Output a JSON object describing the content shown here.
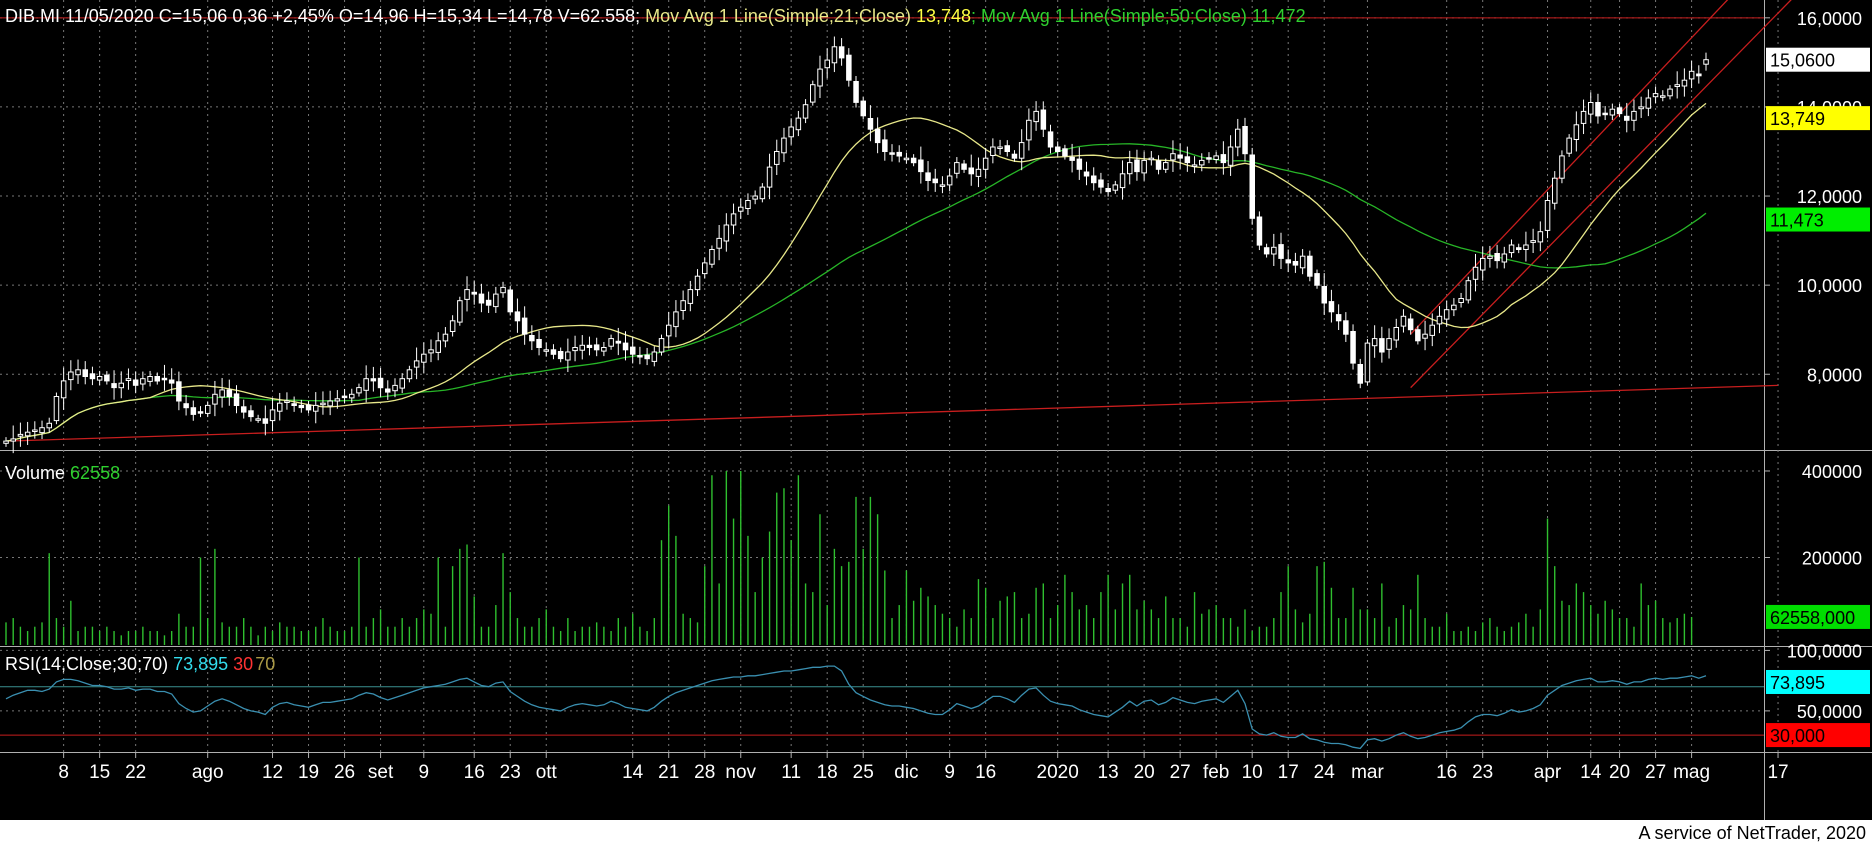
{
  "header": {
    "symbol": "DIB.MI 11/05/2020",
    "ohlc": " C=15,06 0,36 +2,45% O=14,96 H=15,34 L=14,78 V=62.558;",
    "ma21_label": " Mov Avg 1 Line(Simple;21;Close) ",
    "ma21_value": "13,748",
    "ma50_label": "; Mov Avg 1 Line(Simple;50;Close) ",
    "ma50_value": "11,472"
  },
  "colors": {
    "background": "#000000",
    "candle": "#ffffff",
    "ma21": "#e8e88a",
    "ma50": "#27b527",
    "volume": "#2fbf2f",
    "rsi": "#3a8fb0",
    "trendline": "#c81e1e",
    "grid": "#777777",
    "ma21_badge": "#ffff00",
    "ma50_badge": "#00ee00",
    "vol_badge": "#00dd00",
    "rsi_badge": "#00ffff",
    "rsi30_badge": "#ff0000"
  },
  "chart_data": [
    {
      "type": "candlestick",
      "panel": "price",
      "y_ticks": [
        "16,0000",
        "14,0000",
        "12,0000",
        "10,0000",
        "8,0000"
      ],
      "ylim": [
        6.3,
        16.4
      ],
      "badges": {
        "last": "15,0600",
        "ma21": "13,749",
        "ma50": "11,473"
      },
      "series": [
        {
          "name": "Mov Avg 1 Line(Simple;21;Close)",
          "color_key": "ma21"
        },
        {
          "name": "Mov Avg 1 Line(Simple;50;Close)",
          "color_key": "ma50"
        }
      ],
      "close": [
        6.5,
        6.55,
        6.65,
        6.7,
        6.75,
        6.8,
        6.9,
        7.5,
        7.85,
        8.05,
        8.1,
        7.95,
        7.9,
        7.95,
        7.85,
        7.7,
        7.8,
        7.9,
        7.75,
        7.9,
        7.95,
        7.85,
        7.9,
        7.8,
        7.4,
        7.25,
        7.1,
        7.15,
        7.3,
        7.55,
        7.65,
        7.5,
        7.3,
        7.15,
        7.05,
        7.0,
        6.9,
        7.2,
        7.35,
        7.4,
        7.3,
        7.25,
        7.2,
        7.3,
        7.35,
        7.4,
        7.45,
        7.5,
        7.55,
        7.7,
        7.9,
        7.85,
        7.7,
        7.6,
        7.75,
        7.9,
        8.1,
        8.3,
        8.45,
        8.55,
        8.75,
        8.9,
        9.2,
        9.65,
        9.9,
        9.8,
        9.6,
        9.55,
        9.8,
        9.95,
        9.4,
        9.2,
        8.9,
        8.75,
        8.6,
        8.55,
        8.45,
        8.35,
        8.5,
        8.6,
        8.65,
        8.6,
        8.55,
        8.6,
        8.8,
        8.7,
        8.55,
        8.45,
        8.4,
        8.35,
        8.5,
        8.8,
        9.1,
        9.4,
        9.65,
        9.9,
        10.2,
        10.5,
        10.8,
        11.05,
        11.35,
        11.6,
        11.75,
        11.9,
        12.0,
        12.2,
        12.65,
        13.0,
        13.3,
        13.55,
        13.75,
        14.05,
        14.5,
        14.85,
        15.05,
        15.35,
        15.1,
        14.6,
        14.1,
        13.8,
        13.5,
        13.2,
        13.0,
        12.95,
        12.9,
        12.85,
        12.75,
        12.55,
        12.35,
        12.3,
        12.25,
        12.45,
        12.75,
        12.6,
        12.5,
        12.6,
        12.85,
        13.1,
        13.1,
        13.0,
        12.85,
        13.2,
        13.7,
        13.9,
        13.5,
        13.1,
        13.0,
        12.9,
        12.8,
        12.6,
        12.45,
        12.3,
        12.2,
        12.1,
        12.25,
        12.5,
        12.75,
        12.55,
        12.8,
        12.85,
        12.6,
        12.75,
        12.95,
        12.85,
        12.75,
        12.7,
        12.8,
        12.85,
        12.9,
        12.75,
        13.1,
        13.5,
        12.95,
        11.5,
        10.9,
        10.7,
        10.85,
        10.6,
        10.5,
        10.45,
        10.65,
        10.2,
        10.0,
        9.6,
        9.4,
        9.2,
        8.9,
        8.25,
        7.8,
        8.7,
        8.8,
        8.5,
        8.8,
        9.05,
        9.3,
        9.0,
        8.75,
        8.9,
        9.1,
        9.3,
        9.45,
        9.55,
        9.7,
        10.1,
        10.4,
        10.6,
        10.65,
        10.55,
        10.7,
        10.9,
        10.8,
        10.9,
        11.0,
        11.2,
        11.9,
        12.4,
        12.9,
        13.3,
        13.6,
        13.9,
        14.1,
        13.8,
        13.85,
        13.95,
        13.85,
        13.7,
        13.9,
        14.0,
        14.2,
        14.3,
        14.25,
        14.4,
        14.5,
        14.6,
        14.8,
        14.7,
        15.06
      ]
    },
    {
      "type": "bar",
      "panel": "volume",
      "title": "Volume",
      "value_label": "62558",
      "badge": "62558,000",
      "y_ticks": [
        "400000",
        "200000"
      ],
      "ylim": [
        0,
        430000
      ],
      "values": [
        50000,
        60000,
        40000,
        30000,
        40000,
        50000,
        210000,
        60000,
        40000,
        100000,
        30000,
        40000,
        40000,
        30000,
        40000,
        30000,
        20000,
        30000,
        30000,
        40000,
        30000,
        30000,
        20000,
        30000,
        70000,
        40000,
        40000,
        200000,
        60000,
        220000,
        50000,
        40000,
        40000,
        60000,
        40000,
        20000,
        40000,
        30000,
        50000,
        40000,
        40000,
        30000,
        30000,
        40000,
        60000,
        40000,
        30000,
        30000,
        40000,
        200000,
        40000,
        60000,
        80000,
        40000,
        40000,
        60000,
        40000,
        60000,
        80000,
        70000,
        200000,
        40000,
        180000,
        220000,
        230000,
        110000,
        40000,
        40000,
        90000,
        210000,
        120000,
        60000,
        40000,
        40000,
        60000,
        80000,
        40000,
        30000,
        60000,
        30000,
        40000,
        40000,
        50000,
        40000,
        30000,
        60000,
        40000,
        70000,
        40000,
        30000,
        60000,
        240000,
        320000,
        250000,
        70000,
        60000,
        50000,
        180000,
        390000,
        140000,
        400000,
        290000,
        400000,
        250000,
        120000,
        200000,
        260000,
        350000,
        360000,
        240000,
        390000,
        140000,
        120000,
        300000,
        90000,
        220000,
        180000,
        190000,
        340000,
        220000,
        340000,
        300000,
        170000,
        60000,
        90000,
        170000,
        100000,
        130000,
        110000,
        90000,
        70000,
        60000,
        40000,
        80000,
        60000,
        150000,
        130000,
        60000,
        100000,
        110000,
        120000,
        60000,
        70000,
        130000,
        140000,
        60000,
        90000,
        160000,
        120000,
        80000,
        90000,
        60000,
        120000,
        160000,
        80000,
        140000,
        160000,
        80000,
        100000,
        80000,
        60000,
        110000,
        60000,
        60000,
        40000,
        120000,
        70000,
        80000,
        90000,
        60000,
        60000,
        40000,
        80000,
        30000,
        40000,
        40000,
        60000,
        120000,
        180000,
        80000,
        50000,
        70000,
        180000,
        190000,
        130000,
        60000,
        60000,
        130000,
        80000,
        80000,
        60000,
        140000,
        40000,
        60000,
        90000,
        80000,
        160000,
        60000,
        40000,
        40000,
        70000,
        30000,
        30000,
        40000,
        30000,
        50000,
        60000,
        40000,
        30000,
        40000,
        50000,
        70000,
        40000,
        80000,
        290000,
        180000,
        100000,
        90000,
        140000,
        120000,
        90000,
        70000,
        100000,
        80000,
        60000,
        60000,
        40000,
        140000,
        90000,
        100000,
        60000,
        50000,
        60000,
        70000,
        62558
      ]
    },
    {
      "type": "line",
      "panel": "rsi",
      "title": "RSI(14;Close;30;70)",
      "value_label": "73,895",
      "level_low": "30",
      "level_high": "70",
      "badge_value": "73,895",
      "badge_low": "30,000",
      "y_ticks": [
        "100,0000",
        "50,0000"
      ],
      "ylim": [
        16,
        102
      ],
      "values": [
        60,
        63,
        65,
        67,
        67,
        66,
        68,
        74,
        76,
        76,
        75,
        73,
        71,
        71,
        70,
        68,
        68,
        69,
        67,
        68,
        68,
        66,
        66,
        64,
        56,
        52,
        49,
        50,
        54,
        58,
        60,
        58,
        55,
        52,
        50,
        49,
        47,
        53,
        56,
        57,
        55,
        54,
        53,
        55,
        57,
        57,
        58,
        59,
        60,
        63,
        65,
        64,
        61,
        59,
        61,
        63,
        65,
        67,
        69,
        70,
        71,
        72,
        74,
        76,
        77,
        74,
        71,
        70,
        73,
        74,
        66,
        62,
        58,
        55,
        53,
        52,
        51,
        50,
        53,
        55,
        56,
        55,
        54,
        55,
        58,
        56,
        53,
        52,
        51,
        50,
        53,
        58,
        62,
        65,
        67,
        69,
        71,
        73,
        75,
        76,
        77,
        78,
        78,
        79,
        79,
        80,
        81,
        82,
        83,
        83,
        84,
        85,
        86,
        86,
        87,
        87,
        83,
        72,
        65,
        62,
        59,
        57,
        55,
        54,
        54,
        53,
        52,
        50,
        48,
        47,
        47,
        51,
        56,
        54,
        52,
        54,
        58,
        62,
        62,
        60,
        57,
        63,
        68,
        69,
        63,
        58,
        56,
        55,
        54,
        51,
        49,
        47,
        46,
        45,
        49,
        53,
        58,
        54,
        58,
        59,
        55,
        57,
        61,
        59,
        57,
        56,
        58,
        59,
        60,
        57,
        62,
        67,
        56,
        35,
        31,
        30,
        32,
        29,
        28,
        28,
        31,
        27,
        26,
        24,
        23,
        23,
        22,
        20,
        19,
        26,
        27,
        25,
        27,
        30,
        32,
        29,
        27,
        28,
        30,
        32,
        33,
        34,
        36,
        41,
        45,
        47,
        47,
        46,
        48,
        51,
        49,
        50,
        52,
        55,
        63,
        67,
        71,
        73,
        75,
        76,
        77,
        74,
        74,
        75,
        74,
        72,
        74,
        74,
        76,
        77,
        76,
        77,
        77,
        78,
        79,
        77,
        79
      ]
    }
  ],
  "x_axis_labels": [
    {
      "label": "8",
      "i": 8
    },
    {
      "label": "15",
      "i": 13
    },
    {
      "label": "22",
      "i": 18
    },
    {
      "label": "ago",
      "i": 28
    },
    {
      "label": "12",
      "i": 37
    },
    {
      "label": "19",
      "i": 42
    },
    {
      "label": "26",
      "i": 47
    },
    {
      "label": "set",
      "i": 52
    },
    {
      "label": "9",
      "i": 58
    },
    {
      "label": "16",
      "i": 65
    },
    {
      "label": "23",
      "i": 70
    },
    {
      "label": "ott",
      "i": 75
    },
    {
      "label": "14",
      "i": 87
    },
    {
      "label": "21",
      "i": 92
    },
    {
      "label": "28",
      "i": 97
    },
    {
      "label": "nov",
      "i": 102
    },
    {
      "label": "11",
      "i": 109
    },
    {
      "label": "18",
      "i": 114
    },
    {
      "label": "25",
      "i": 119
    },
    {
      "label": "dic",
      "i": 125
    },
    {
      "label": "9",
      "i": 131
    },
    {
      "label": "16",
      "i": 136
    },
    {
      "label": "2020",
      "i": 146
    },
    {
      "label": "13",
      "i": 153
    },
    {
      "label": "20",
      "i": 158
    },
    {
      "label": "27",
      "i": 163
    },
    {
      "label": "feb",
      "i": 168
    },
    {
      "label": "10",
      "i": 173
    },
    {
      "label": "17",
      "i": 178
    },
    {
      "label": "24",
      "i": 183
    },
    {
      "label": "mar",
      "i": 189
    },
    {
      "label": "16",
      "i": 200
    },
    {
      "label": "23",
      "i": 205
    },
    {
      "label": "apr",
      "i": 214
    },
    {
      "label": "14",
      "i": 220
    },
    {
      "label": "20",
      "i": 224
    },
    {
      "label": "27",
      "i": 229
    },
    {
      "label": "mag",
      "i": 234
    },
    {
      "label": "17",
      "i": 246
    }
  ],
  "footer": {
    "text": "A service of NetTrader, 2020"
  }
}
